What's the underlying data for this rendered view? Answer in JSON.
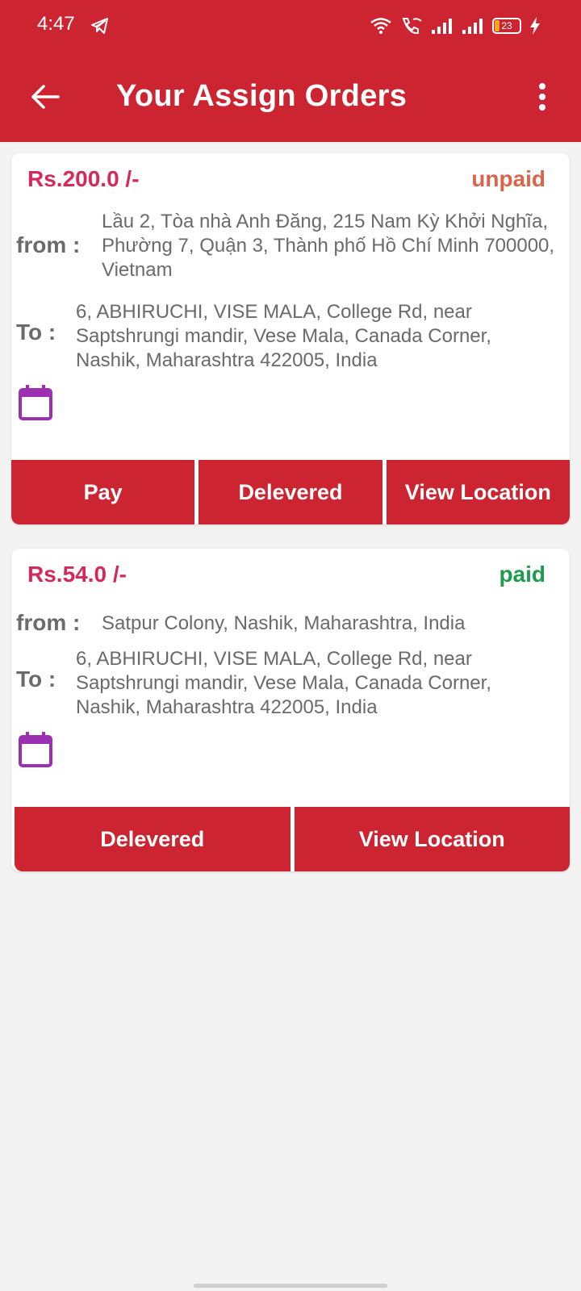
{
  "status_bar": {
    "time": "4:47",
    "battery_level": "23",
    "icons": [
      "telegram-icon",
      "wifi-icon",
      "wifi-calling-icon",
      "signal-icon",
      "signal-icon",
      "battery-icon",
      "charging-icon"
    ]
  },
  "app_bar": {
    "title": "Your Assign Orders",
    "back_icon": "arrow-left-icon",
    "menu_icon": "more-vert-icon"
  },
  "colors": {
    "primary": "#cc2430",
    "price": "#d42a5a",
    "unpaid": "#d9664a",
    "paid": "#1f9a4e",
    "calendar": "#9b30b0"
  },
  "orders": [
    {
      "price": "Rs.200.0  /-",
      "status": "unpaid",
      "from_label": "from :",
      "from": "Lầu 2, Tòa nhà Anh Đăng, 215 Nam Kỳ Khởi Nghĩa, Phường 7, Quận 3, Thành phố Hồ Chí Minh 700000, Vietnam",
      "to_label": "To :",
      "to": "6, ABHIRUCHI, VISE MALA, College Rd, near Saptshrungi mandir, Vese Mala, Canada Corner, Nashik, Maharashtra 422005, India",
      "buttons": [
        "Pay",
        "Delevered",
        "View Location"
      ]
    },
    {
      "price": "Rs.54.0  /-",
      "status": "paid",
      "from_label": "from :",
      "from": "Satpur Colony, Nashik, Maharashtra, India",
      "to_label": "To :",
      "to": "6, ABHIRUCHI, VISE MALA, College Rd, near Saptshrungi mandir, Vese Mala, Canada Corner, Nashik, Maharashtra 422005, India",
      "buttons": [
        "Delevered",
        "View Location"
      ]
    }
  ]
}
